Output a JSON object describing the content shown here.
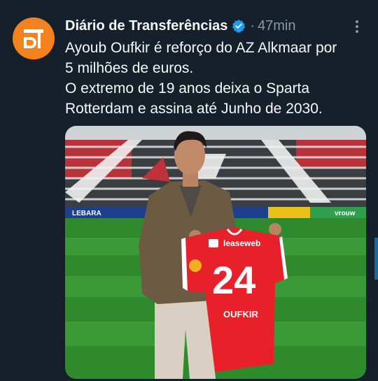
{
  "tweet": {
    "author_name": "Diário de Transferências",
    "time": "47min",
    "separator": "·",
    "avatar_text": "DT",
    "lines": [
      "Ayoub Oufkir é reforço do AZ Alkmaar por",
      "5 milhões de euros.",
      "O extremo de 19 anos deixa o Sparta",
      "Rotterdam e assina até Junho de 2030."
    ],
    "media": {
      "shirt_number": "24",
      "shirt_name": "OUFKIR",
      "shirt_sponsor": "leaseweb",
      "board_left": "LEBARA",
      "board_right": "vrouw"
    }
  },
  "colors": {
    "background": "#15202b",
    "verified": "#1d9bf0",
    "avatar": "#f5821f",
    "secondary_text": "#8b98a5",
    "shirt": "#e8202a"
  },
  "icons": {
    "verified": "verified-badge-icon",
    "more": "more-options-icon"
  }
}
